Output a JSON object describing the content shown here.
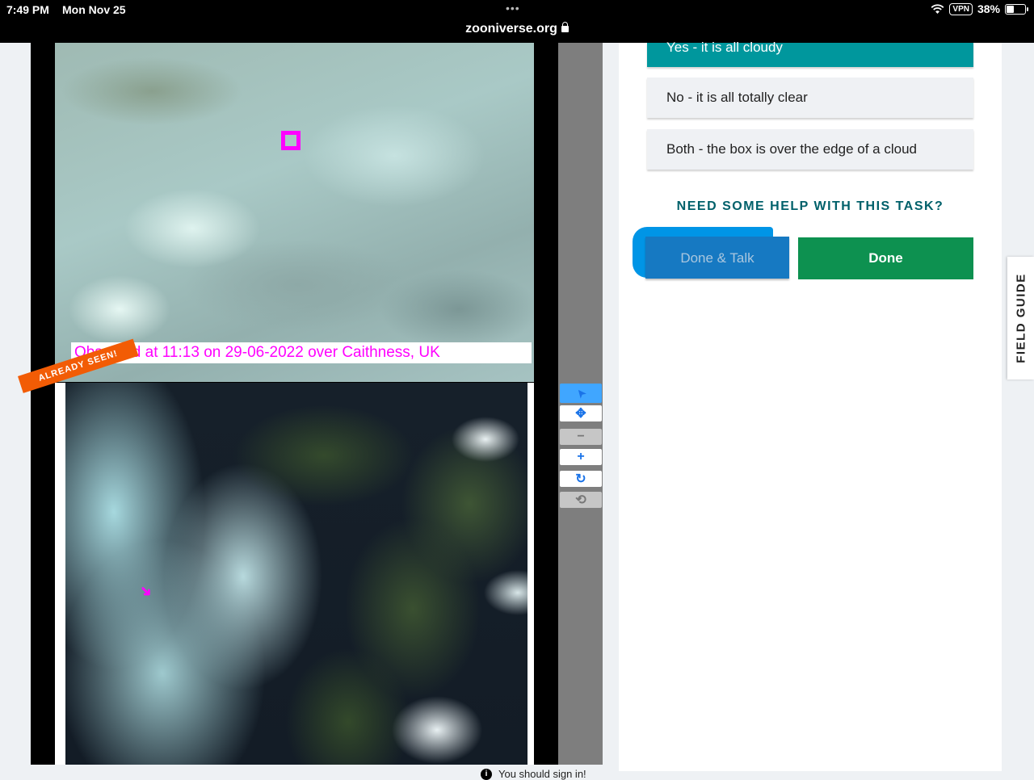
{
  "status_bar": {
    "time": "7:49 PM",
    "date": "Mon Nov 25",
    "dots": "•••",
    "vpn": "VPN",
    "battery": "38%"
  },
  "browser": {
    "url": "zooniverse.org"
  },
  "viewer": {
    "caption": "Observed at 11:13 on 29-06-2022 over Caithness, UK",
    "already_seen": "ALREADY SEEN!",
    "tools": {
      "pointer": "➤",
      "move": "✥",
      "zoom_out": "−",
      "zoom_in": "+",
      "rotate": "↻",
      "reset": "⟲"
    }
  },
  "task": {
    "answers": [
      "Yes - it is all cloudy",
      "No - it is all totally clear",
      "Both - the box is over the edge of a cloud"
    ],
    "help_link": "NEED SOME HELP WITH THIS TASK?",
    "done_talk_label": "Done & Talk",
    "done_label": "Done"
  },
  "field_guide": {
    "label": "FIELD GUIDE"
  },
  "footer": {
    "signin_note": "You should sign in!"
  },
  "colors": {
    "selected_answer": "#00979d",
    "done_button": "#0d9150",
    "talk_button": "#1679c2",
    "marker": "#ff00ff",
    "already_seen_badge": "#f25c05"
  }
}
